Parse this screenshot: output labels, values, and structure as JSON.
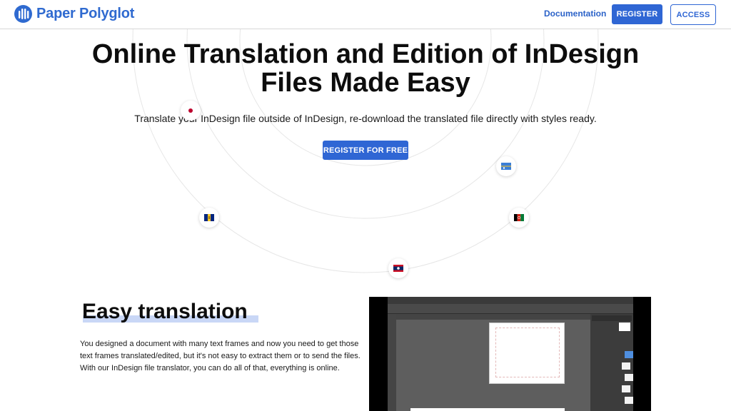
{
  "nav": {
    "brand": "Paper Polyglot",
    "documentation": "Documentation",
    "register": "REGISTER",
    "access": "ACCESS"
  },
  "hero": {
    "title": "Online Translation and Edition of InDesign Files Made Easy",
    "subtitle": "Translate your InDesign file outside of InDesign, re-download the translated file directly with styles ready.",
    "cta": "REGISTER FOR FREE",
    "flags": [
      "japan-flag-icon",
      "barbados-flag-icon",
      "laos-flag-icon",
      "afghanistan-flag-icon",
      "nauru-flag-icon"
    ]
  },
  "feature": {
    "title": "Easy translation",
    "text": "You designed a document with many text frames and now you need to get those text frames translated/edited, but it's not easy to extract them or to send the files. With our InDesign file translator, you can do all of that, everything is online."
  },
  "colors": {
    "accent": "#2f66d4",
    "underline": "#c9d7f6"
  }
}
